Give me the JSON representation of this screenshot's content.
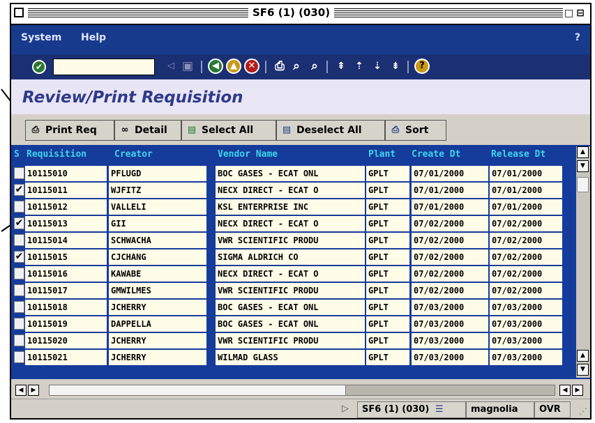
{
  "window": {
    "title": "SF6 (1) (030)"
  },
  "menu": {
    "system": "System",
    "help": "Help",
    "help_q": "?"
  },
  "page": {
    "title": "Review/Print Requisition"
  },
  "buttons": {
    "print_req": "Print Req",
    "detail": "Detail",
    "select_all": "Select All",
    "deselect_all": "Deselect All",
    "sort": "Sort"
  },
  "table": {
    "headers": {
      "s": "S",
      "requisition": "Requisition",
      "creator": "Creator",
      "vendor": "Vendor Name",
      "plant": "Plant",
      "create_dt": "Create Dt",
      "release_dt": "Release Dt"
    },
    "rows": [
      {
        "checked": "",
        "req": "10115010",
        "creator": "PFLUGD",
        "vendor": "BOC GASES - ECAT ONL",
        "plant": "GPLT",
        "create": "07/01/2000",
        "release": "07/01/2000"
      },
      {
        "checked": "✔",
        "req": "10115011",
        "creator": "WJFITZ",
        "vendor": "NECX DIRECT - ECAT O",
        "plant": "GPLT",
        "create": "07/01/2000",
        "release": "07/01/2000"
      },
      {
        "checked": "",
        "req": "10115012",
        "creator": "VALLELI",
        "vendor": "KSL ENTERPRISE INC",
        "plant": "GPLT",
        "create": "07/01/2000",
        "release": "07/01/2000"
      },
      {
        "checked": "✔",
        "req": "10115013",
        "creator": "GII",
        "vendor": "NECX DIRECT - ECAT O",
        "plant": "GPLT",
        "create": "07/02/2000",
        "release": "07/02/2000"
      },
      {
        "checked": "",
        "req": "10115014",
        "creator": "SCHWACHA",
        "vendor": "VWR SCIENTIFIC PRODU",
        "plant": "GPLT",
        "create": "07/02/2000",
        "release": "07/02/2000"
      },
      {
        "checked": "✔",
        "req": "10115015",
        "creator": "CJCHANG",
        "vendor": "SIGMA ALDRICH CO",
        "plant": "GPLT",
        "create": "07/02/2000",
        "release": "07/02/2000"
      },
      {
        "checked": "",
        "req": "10115016",
        "creator": "KAWABE",
        "vendor": "NECX DIRECT - ECAT O",
        "plant": "GPLT",
        "create": "07/02/2000",
        "release": "07/02/2000"
      },
      {
        "checked": "",
        "req": "10115017",
        "creator": "GMWILMES",
        "vendor": "VWR SCIENTIFIC PRODU",
        "plant": "GPLT",
        "create": "07/02/2000",
        "release": "07/02/2000"
      },
      {
        "checked": "",
        "req": "10115018",
        "creator": "JCHERRY",
        "vendor": "BOC GASES - ECAT ONL",
        "plant": "GPLT",
        "create": "07/03/2000",
        "release": "07/03/2000"
      },
      {
        "checked": "",
        "req": "10115019",
        "creator": "DAPPELLA",
        "vendor": "BOC GASES - ECAT ONL",
        "plant": "GPLT",
        "create": "07/03/2000",
        "release": "07/03/2000"
      },
      {
        "checked": "",
        "req": "10115020",
        "creator": "JCHERRY",
        "vendor": "VWR SCIENTIFIC PRODU",
        "plant": "GPLT",
        "create": "07/03/2000",
        "release": "07/03/2000"
      },
      {
        "checked": "",
        "req": "10115021",
        "creator": "JCHERRY",
        "vendor": "WILMAD GLASS",
        "plant": "GPLT",
        "create": "07/03/2000",
        "release": "07/03/2000"
      }
    ]
  },
  "status": {
    "system": "SF6 (1) (030)",
    "server": "magnolia",
    "mode": "OVR"
  },
  "icons": {
    "enter": "checkmark-icon",
    "back": "back-arrow-icon",
    "save": "save-icon",
    "green_back": "green-back-icon",
    "exit": "exit-icon",
    "cancel": "cancel-icon",
    "print": "print-icon",
    "find": "find-icon",
    "find_next": "find-next-icon",
    "first_page": "first-page-icon",
    "prev_page": "previous-page-icon",
    "next_page": "next-page-icon",
    "last_page": "last-page-icon",
    "help": "help-icon"
  }
}
